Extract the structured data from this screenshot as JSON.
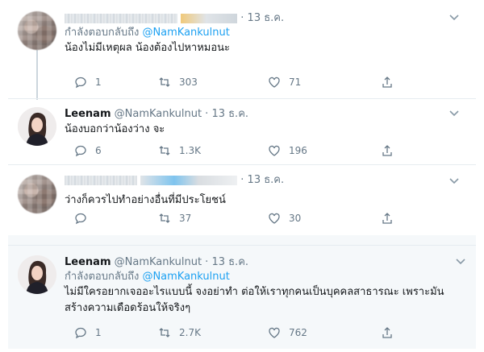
{
  "tweets": [
    {
      "date": "· 13 ธ.ค.",
      "replying_prefix": "กำลังตอบกลับถึง",
      "replying_to": "@NamKankulnut",
      "text": "น้องไม่มีเหตุผล น้องต้องไปหาหมอนะ",
      "replies": "1",
      "retweets": "303",
      "likes": "71"
    },
    {
      "name": "Leenam",
      "handle": "@NamKankulnut · 13 ธ.ค.",
      "text": "น้องบอกว่าน้องว่าง จะ",
      "replies": "6",
      "retweets": "1.3K",
      "likes": "196"
    },
    {
      "date": "· 13 ธ.ค.",
      "text": "ว่างก็ควรไปทำอย่างอื่นที่มีประโยชน์",
      "replies": "",
      "retweets": "37",
      "likes": "30"
    },
    {
      "name": "Leenam",
      "handle": "@NamKankulnut · 13 ธ.ค.",
      "replying_prefix": "กำลังตอบกลับถึง",
      "replying_to": "@NamKankulnut",
      "text_line1": "ไม่มีใครอยากเจออะไรแบบนี้ จงอย่าทำ ต่อให้เราทุกคนเป็นบุคคลสาธารณะ เพราะมัน",
      "text_line2": "สร้างความเดือดร้อนให้จริงๆ",
      "replies": "1",
      "retweets": "2.7K",
      "likes": "762"
    }
  ],
  "icons": {
    "chevron": "chevron-down-icon",
    "reply": "reply-icon",
    "retweet": "retweet-icon",
    "like": "heart-icon",
    "share": "share-icon"
  },
  "colors": {
    "accent": "#1da1f2",
    "muted": "#657786",
    "border": "#e6ecf0"
  }
}
